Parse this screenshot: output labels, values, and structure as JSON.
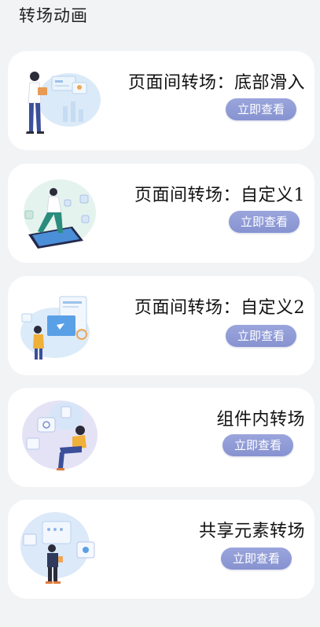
{
  "page": {
    "title": "转场动画"
  },
  "cards": [
    {
      "title": "页面间转场：底部滑入",
      "button": "立即查看"
    },
    {
      "title": "页面间转场：自定义1",
      "button": "立即查看"
    },
    {
      "title": "页面间转场：自定义2",
      "button": "立即查看"
    },
    {
      "title": "组件内转场",
      "button": "立即查看"
    },
    {
      "title": "共享元素转场",
      "button": "立即查看"
    }
  ],
  "colors": {
    "background": "#f1f3f5",
    "card": "#ffffff",
    "button": "#8f9bd6"
  }
}
